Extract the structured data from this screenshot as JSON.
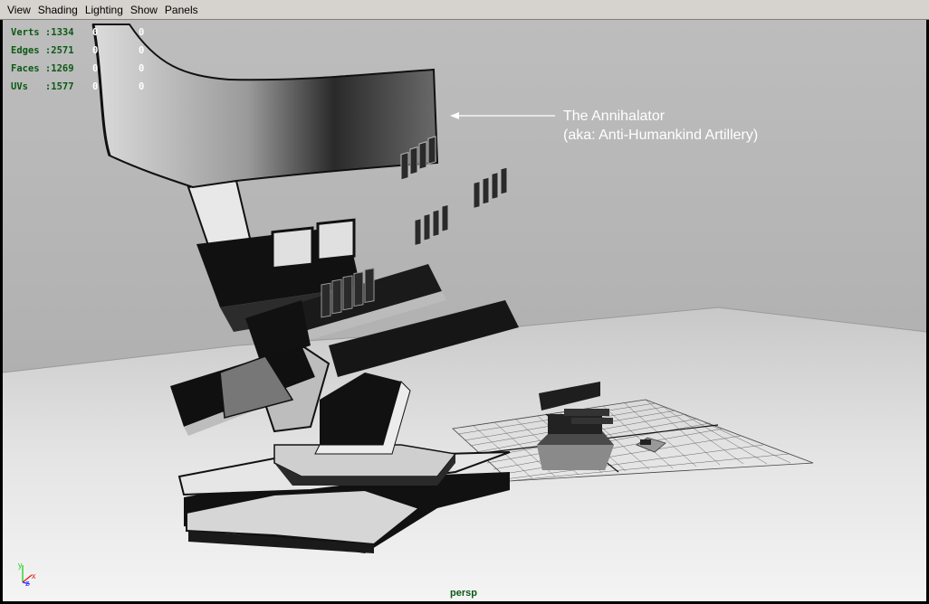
{
  "menu": [
    {
      "label": "View"
    },
    {
      "label": "Shading"
    },
    {
      "label": "Lighting"
    },
    {
      "label": "Show"
    },
    {
      "label": "Panels"
    }
  ],
  "hud": {
    "rows": [
      {
        "label": "Verts :1334",
        "c1": "0",
        "c2": "0"
      },
      {
        "label": "Edges :2571",
        "c1": "0",
        "c2": "0"
      },
      {
        "label": "Faces :1269",
        "c1": "0",
        "c2": "0"
      },
      {
        "label": "UVs   :1577",
        "c1": "0",
        "c2": "0"
      }
    ]
  },
  "annotation": {
    "line1": "The Annihalator",
    "line2": "(aka: Anti-Humankind Artillery)"
  },
  "camera_label": "persp",
  "axis": {
    "y": "y",
    "z": "z",
    "x": "x"
  },
  "colors": {
    "menubar": "#d6d3ce",
    "hud_text": "#0b5a14",
    "axis_x": "#e02020",
    "axis_y": "#2ad22a",
    "axis_z": "#2a2aff"
  }
}
